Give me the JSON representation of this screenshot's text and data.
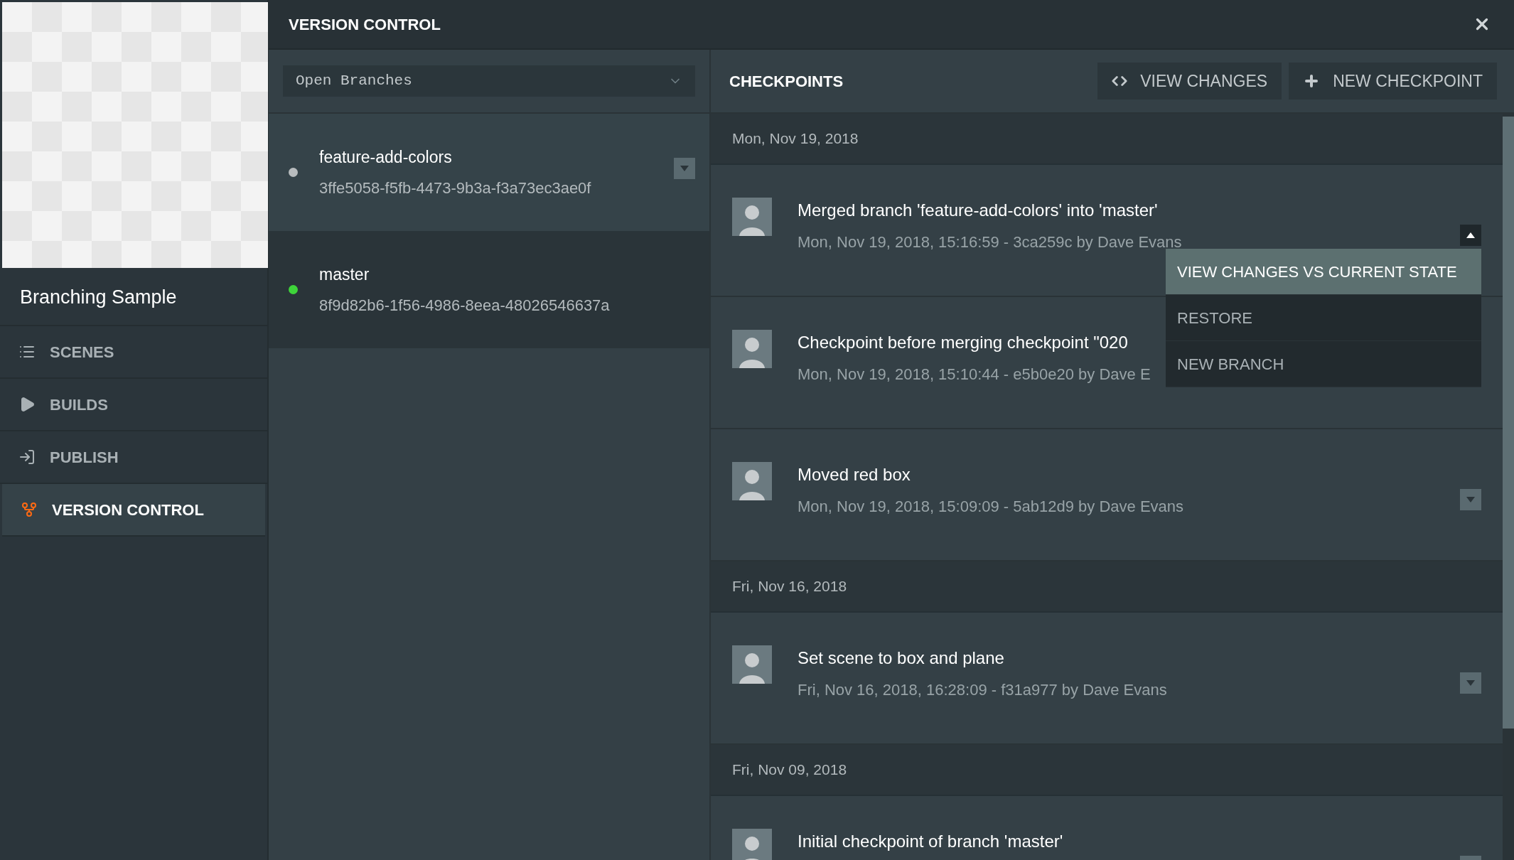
{
  "sidebar": {
    "project_name": "Branching Sample",
    "nav": [
      {
        "label": "SCENES",
        "selected": false
      },
      {
        "label": "BUILDS",
        "selected": false
      },
      {
        "label": "PUBLISH",
        "selected": false
      },
      {
        "label": "VERSION CONTROL",
        "selected": true
      }
    ]
  },
  "panel": {
    "title": "VERSION CONTROL"
  },
  "branches": {
    "filter": {
      "value": "Open Branches"
    },
    "items": [
      {
        "name": "feature-add-colors",
        "id": "3ffe5058-f5fb-4473-9b3a-f3a73ec3ae0f",
        "color": "#b8bcbe",
        "selected": false,
        "menu_button": true
      },
      {
        "name": "master",
        "id": "8f9d82b6-1f56-4986-8eea-48026546637a",
        "color": "#3ed43a",
        "selected": true,
        "menu_button": false
      }
    ]
  },
  "checkpoints": {
    "title": "CHECKPOINTS",
    "buttons": [
      {
        "label": "VIEW CHANGES"
      },
      {
        "label": "NEW CHECKPOINT"
      }
    ],
    "groups": [
      {
        "date": "Mon, Nov 19, 2018",
        "items": [
          {
            "title": "Merged branch 'feature-add-colors' into 'master'",
            "meta": "Mon, Nov 19, 2018, 15:16:59 - 3ca259c by Dave Evans",
            "expanded": true,
            "menu": [
              {
                "label": "VIEW CHANGES VS CURRENT STATE",
                "selected": true
              },
              {
                "label": "RESTORE",
                "selected": false
              },
              {
                "label": "NEW BRANCH",
                "selected": false
              }
            ]
          },
          {
            "title": "Checkpoint before merging checkpoint \"020",
            "meta": "Mon, Nov 19, 2018, 15:10:44 - e5b0e20 by Dave E"
          },
          {
            "title": "Moved red box",
            "meta": "Mon, Nov 19, 2018, 15:09:09 - 5ab12d9 by Dave Evans",
            "expanded": false
          }
        ]
      },
      {
        "date": "Fri, Nov 16, 2018",
        "items": [
          {
            "title": "Set scene to box and plane",
            "meta": "Fri, Nov 16, 2018, 16:28:09 - f31a977 by Dave Evans",
            "expanded": false
          }
        ]
      },
      {
        "date": "Fri, Nov 09, 2018",
        "items": [
          {
            "title": "Initial checkpoint of branch 'master'",
            "expanded": false
          }
        ]
      }
    ]
  }
}
